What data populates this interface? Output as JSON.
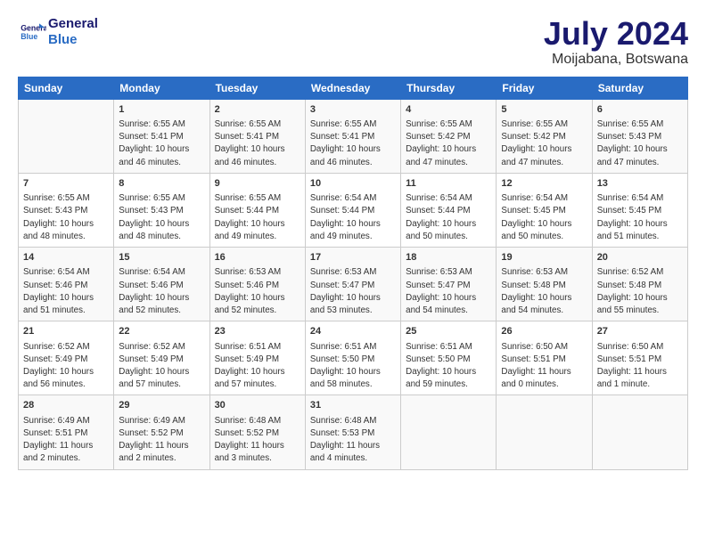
{
  "header": {
    "logo_line1": "General",
    "logo_line2": "Blue",
    "title": "July 2024",
    "subtitle": "Moijabana, Botswana"
  },
  "days_of_week": [
    "Sunday",
    "Monday",
    "Tuesday",
    "Wednesday",
    "Thursday",
    "Friday",
    "Saturday"
  ],
  "weeks": [
    [
      {
        "num": "",
        "info": ""
      },
      {
        "num": "1",
        "info": "Sunrise: 6:55 AM\nSunset: 5:41 PM\nDaylight: 10 hours\nand 46 minutes."
      },
      {
        "num": "2",
        "info": "Sunrise: 6:55 AM\nSunset: 5:41 PM\nDaylight: 10 hours\nand 46 minutes."
      },
      {
        "num": "3",
        "info": "Sunrise: 6:55 AM\nSunset: 5:41 PM\nDaylight: 10 hours\nand 46 minutes."
      },
      {
        "num": "4",
        "info": "Sunrise: 6:55 AM\nSunset: 5:42 PM\nDaylight: 10 hours\nand 47 minutes."
      },
      {
        "num": "5",
        "info": "Sunrise: 6:55 AM\nSunset: 5:42 PM\nDaylight: 10 hours\nand 47 minutes."
      },
      {
        "num": "6",
        "info": "Sunrise: 6:55 AM\nSunset: 5:43 PM\nDaylight: 10 hours\nand 47 minutes."
      }
    ],
    [
      {
        "num": "7",
        "info": "Sunrise: 6:55 AM\nSunset: 5:43 PM\nDaylight: 10 hours\nand 48 minutes."
      },
      {
        "num": "8",
        "info": "Sunrise: 6:55 AM\nSunset: 5:43 PM\nDaylight: 10 hours\nand 48 minutes."
      },
      {
        "num": "9",
        "info": "Sunrise: 6:55 AM\nSunset: 5:44 PM\nDaylight: 10 hours\nand 49 minutes."
      },
      {
        "num": "10",
        "info": "Sunrise: 6:54 AM\nSunset: 5:44 PM\nDaylight: 10 hours\nand 49 minutes."
      },
      {
        "num": "11",
        "info": "Sunrise: 6:54 AM\nSunset: 5:44 PM\nDaylight: 10 hours\nand 50 minutes."
      },
      {
        "num": "12",
        "info": "Sunrise: 6:54 AM\nSunset: 5:45 PM\nDaylight: 10 hours\nand 50 minutes."
      },
      {
        "num": "13",
        "info": "Sunrise: 6:54 AM\nSunset: 5:45 PM\nDaylight: 10 hours\nand 51 minutes."
      }
    ],
    [
      {
        "num": "14",
        "info": "Sunrise: 6:54 AM\nSunset: 5:46 PM\nDaylight: 10 hours\nand 51 minutes."
      },
      {
        "num": "15",
        "info": "Sunrise: 6:54 AM\nSunset: 5:46 PM\nDaylight: 10 hours\nand 52 minutes."
      },
      {
        "num": "16",
        "info": "Sunrise: 6:53 AM\nSunset: 5:46 PM\nDaylight: 10 hours\nand 52 minutes."
      },
      {
        "num": "17",
        "info": "Sunrise: 6:53 AM\nSunset: 5:47 PM\nDaylight: 10 hours\nand 53 minutes."
      },
      {
        "num": "18",
        "info": "Sunrise: 6:53 AM\nSunset: 5:47 PM\nDaylight: 10 hours\nand 54 minutes."
      },
      {
        "num": "19",
        "info": "Sunrise: 6:53 AM\nSunset: 5:48 PM\nDaylight: 10 hours\nand 54 minutes."
      },
      {
        "num": "20",
        "info": "Sunrise: 6:52 AM\nSunset: 5:48 PM\nDaylight: 10 hours\nand 55 minutes."
      }
    ],
    [
      {
        "num": "21",
        "info": "Sunrise: 6:52 AM\nSunset: 5:49 PM\nDaylight: 10 hours\nand 56 minutes."
      },
      {
        "num": "22",
        "info": "Sunrise: 6:52 AM\nSunset: 5:49 PM\nDaylight: 10 hours\nand 57 minutes."
      },
      {
        "num": "23",
        "info": "Sunrise: 6:51 AM\nSunset: 5:49 PM\nDaylight: 10 hours\nand 57 minutes."
      },
      {
        "num": "24",
        "info": "Sunrise: 6:51 AM\nSunset: 5:50 PM\nDaylight: 10 hours\nand 58 minutes."
      },
      {
        "num": "25",
        "info": "Sunrise: 6:51 AM\nSunset: 5:50 PM\nDaylight: 10 hours\nand 59 minutes."
      },
      {
        "num": "26",
        "info": "Sunrise: 6:50 AM\nSunset: 5:51 PM\nDaylight: 11 hours\nand 0 minutes."
      },
      {
        "num": "27",
        "info": "Sunrise: 6:50 AM\nSunset: 5:51 PM\nDaylight: 11 hours\nand 1 minute."
      }
    ],
    [
      {
        "num": "28",
        "info": "Sunrise: 6:49 AM\nSunset: 5:51 PM\nDaylight: 11 hours\nand 2 minutes."
      },
      {
        "num": "29",
        "info": "Sunrise: 6:49 AM\nSunset: 5:52 PM\nDaylight: 11 hours\nand 2 minutes."
      },
      {
        "num": "30",
        "info": "Sunrise: 6:48 AM\nSunset: 5:52 PM\nDaylight: 11 hours\nand 3 minutes."
      },
      {
        "num": "31",
        "info": "Sunrise: 6:48 AM\nSunset: 5:53 PM\nDaylight: 11 hours\nand 4 minutes."
      },
      {
        "num": "",
        "info": ""
      },
      {
        "num": "",
        "info": ""
      },
      {
        "num": "",
        "info": ""
      }
    ]
  ]
}
